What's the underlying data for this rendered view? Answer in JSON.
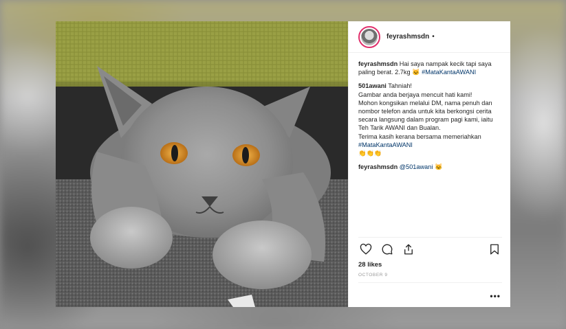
{
  "post": {
    "username": "feyrashmsdn",
    "dot": "•",
    "caption": {
      "user": "feyrashmsdn",
      "text": "Hai saya nampak kecik tapi saya paling berat. 2.7kg 🐱",
      "hashtag": "#MataKantaAWANI"
    },
    "reply": {
      "user": "501awani",
      "lines": [
        "Tahniah!",
        "Gambar anda berjaya mencuit hati kami!",
        "Mohon kongsikan melalui DM, nama penuh dan nombor telefon anda untuk kita berkongsi cerita secara langsung dalam program pagi kami, iaitu Teh Tarik AWANI dan Bualan.",
        "Terima kasih kerana bersama memeriahkan"
      ],
      "hashtag": "#MataKantaAWANI",
      "emoji": "👏👏👏"
    },
    "mention": {
      "user": "feyrashmsdn",
      "handle": "@501awani",
      "emoji": "🐱"
    },
    "likes": "28 likes",
    "date": "OCTOBER 9",
    "more": "•••"
  },
  "icons": {
    "like": "heart-icon",
    "comment": "comment-icon",
    "share": "share-icon",
    "save": "bookmark-icon"
  },
  "colors": {
    "text": "#262626",
    "hashtag": "#003569",
    "avatar_ring": "#e1306c"
  }
}
